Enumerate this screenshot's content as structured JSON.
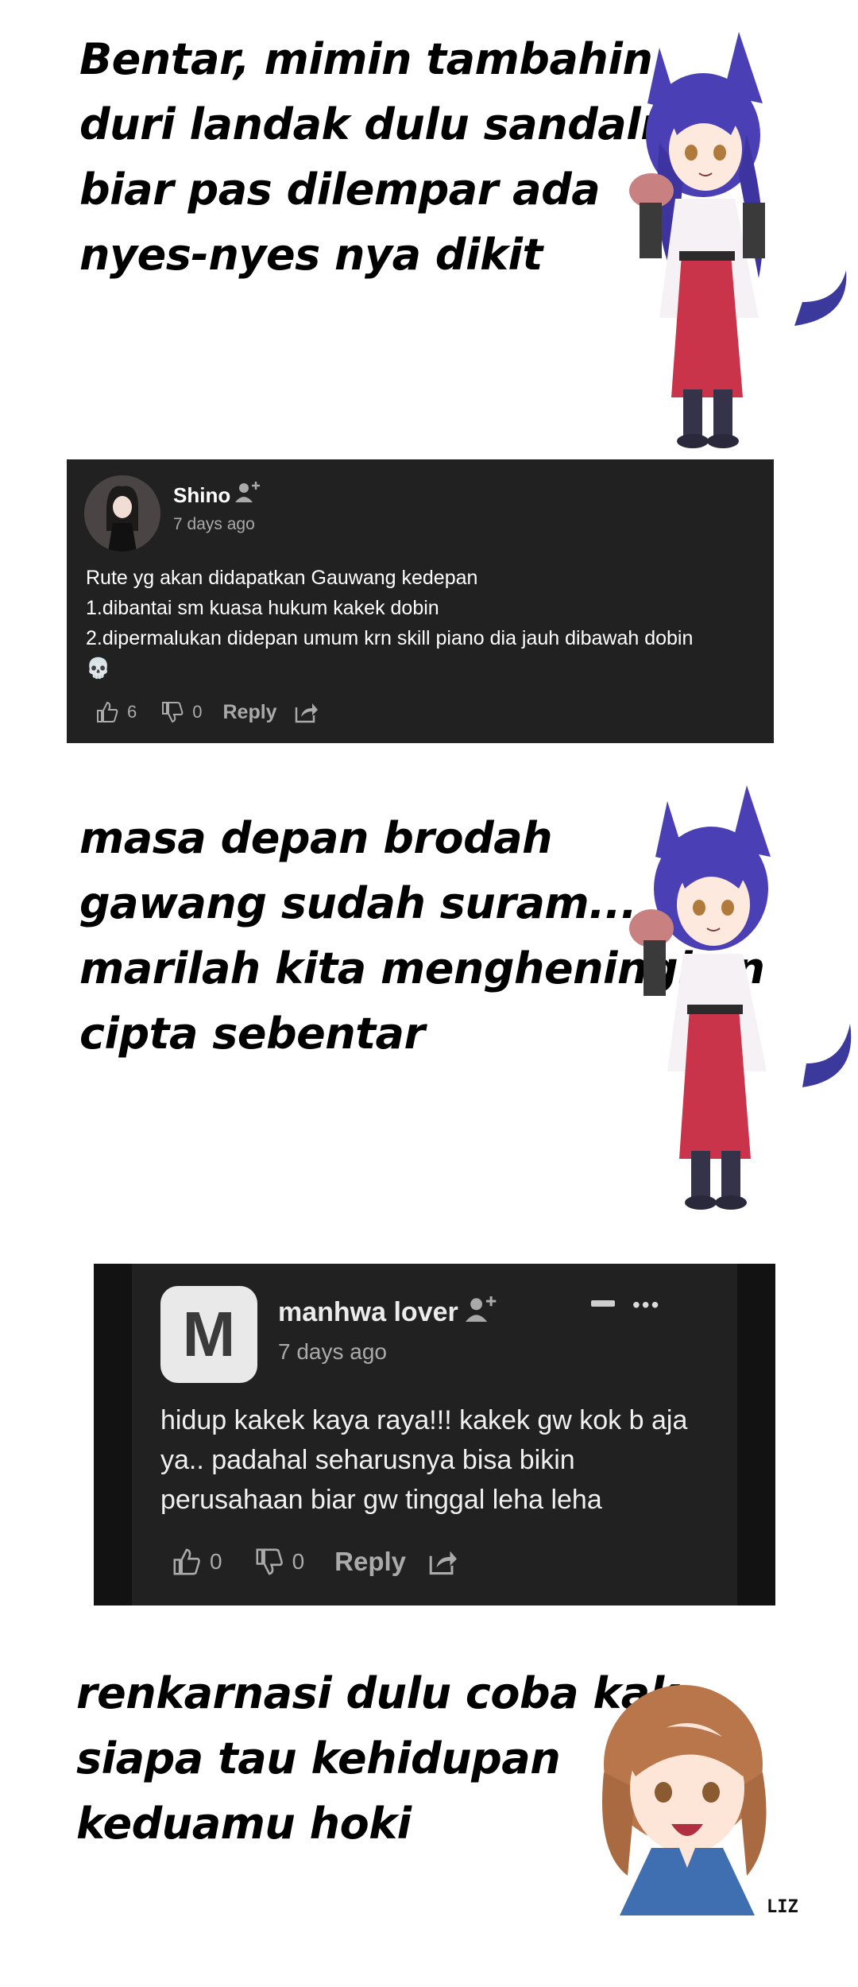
{
  "captions": {
    "first": [
      "Bentar, mimin tambahin",
      " duri landak dulu sandalnya,",
      "biar pas dilempar ada",
      "nyes-nyes nya dikit"
    ],
    "second": [
      "masa depan brodah",
      "gawang sudah suram...",
      "marilah kita mengheningkan",
      "cipta sebentar"
    ],
    "third": [
      "renkarnasi dulu coba kak,",
      "siapa tau kehidupan",
      "keduamu hoki"
    ]
  },
  "comment1": {
    "author": "Shino",
    "time": "7 days ago",
    "lines": [
      "Rute yg akan didapatkan Gauwang kedepan",
      "1.dibantai sm kuasa hukum kakek dobin",
      "2.dipermalukan didepan umum krn skill piano dia jauh dibawah dobin",
      "💀"
    ],
    "likes": "6",
    "dislikes": "0",
    "reply_label": "Reply"
  },
  "comment2": {
    "avatar_letter": "M",
    "author": "manhwa lover",
    "time": "7 days ago",
    "lines": [
      "hidup kakek kaya raya!!! kakek gw kok b aja",
      "ya.. padahal seharusnya bisa bikin",
      "perusahaan biar gw tinggal leha leha"
    ],
    "likes": "0",
    "dislikes": "0",
    "reply_label": "Reply",
    "more_label": "•••"
  },
  "signature": "LIZ",
  "colors": {
    "card_bg": "#212121",
    "text_muted": "#aaaaaa",
    "hair_purple": "#4b3fb5",
    "robe_red": "#c9344a",
    "brown_hair": "#b9764a"
  }
}
